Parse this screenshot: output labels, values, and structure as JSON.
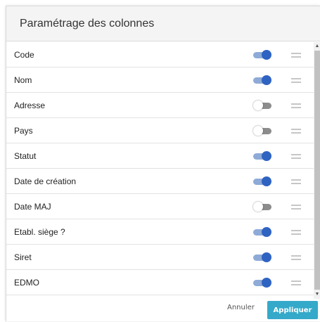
{
  "dialog": {
    "title": "Paramétrage des colonnes"
  },
  "columns": [
    {
      "label": "Code",
      "enabled": true
    },
    {
      "label": "Nom",
      "enabled": true
    },
    {
      "label": "Adresse",
      "enabled": false
    },
    {
      "label": "Pays",
      "enabled": false
    },
    {
      "label": "Statut",
      "enabled": true
    },
    {
      "label": "Date de création",
      "enabled": true
    },
    {
      "label": "Date MAJ",
      "enabled": false
    },
    {
      "label": "Etabl. siège ?",
      "enabled": true
    },
    {
      "label": "Siret",
      "enabled": true
    },
    {
      "label": "EDMO",
      "enabled": true
    }
  ],
  "footer": {
    "cancel_label": "Annuler",
    "apply_label": "Appliquer"
  },
  "icons": {
    "row_handle": "drag-handle-icon",
    "scroll_up": "scroll-up-arrow",
    "scroll_down": "scroll-down-arrow"
  },
  "colors": {
    "toggle_on_knob": "#2f63c2",
    "toggle_on_track": "#8eaad7",
    "toggle_off_track": "#8c8c8c",
    "apply_button": "#35a9c9"
  }
}
